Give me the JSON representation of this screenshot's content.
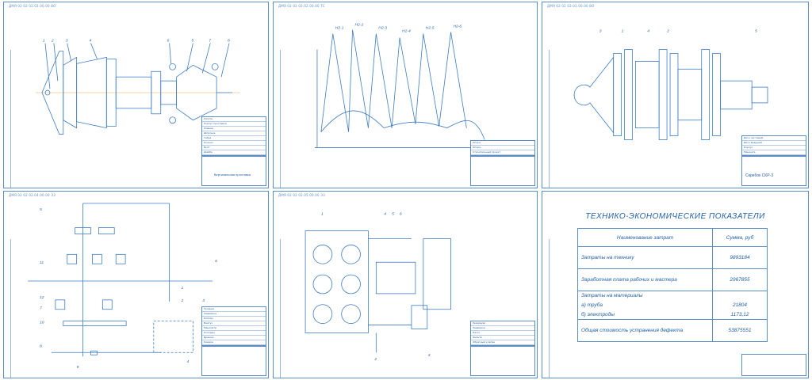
{
  "sheets": {
    "s1": {
      "code": "ДМЯ 02 02 02.02.00.00 ВО",
      "title": "Вертикальная проставка",
      "callouts": [
        "1",
        "2",
        "3",
        "4",
        "6",
        "5",
        "7",
        "8"
      ],
      "spec": [
        "Уплотн.",
        "Корпус проставки",
        "Фланец",
        "Шпилька",
        "Гайка",
        "Кольцо",
        "Болт",
        "Шайба"
      ]
    },
    "s2": {
      "code": "ДМЯ 02 02 02.02.00.00 ТС",
      "dims": [
        "H2-1",
        "H2-2",
        "H2-3",
        "H2-4",
        "H2-5",
        "H2-6"
      ],
      "spec": [
        "Опора",
        "Опора",
        "Строительный проект"
      ]
    },
    "s3": {
      "code": "ДМЯ 02 02 02.03.00.00 ВО",
      "title": "Скребок СКР-3",
      "callouts": [
        "3",
        "1",
        "4",
        "2",
        "5"
      ],
      "spec": [
        "Диск чистящий",
        "Диск ведущий",
        "Корпус",
        "Манжета"
      ]
    },
    "s4": {
      "code": "ДМЯ 02 02 02.04.00.00 Э3",
      "callouts": [
        "5",
        "11",
        "12",
        "7",
        "8",
        "9",
        "10",
        "6",
        "1",
        "2",
        "3",
        "4"
      ],
      "spec": [
        "Тройник",
        "Задвижка",
        "Клапан",
        "Вантуз",
        "Манометр",
        "Колодец",
        "Дренаж",
        "Камера"
      ]
    },
    "s5": {
      "code": "ДМЯ 02 02 02.05.00.00 Э3",
      "callouts": [
        "1",
        "4",
        "5",
        "6",
        "3",
        "2"
      ],
      "spec": [
        "Резервуар",
        "Задвижка",
        "Насос",
        "Фильтр",
        "Обратный клапан"
      ]
    }
  },
  "tep": {
    "title": "ТЕХНИКО-ЭКОНОМИЧЕСКИЕ ПОКАЗАТЕЛИ",
    "col_name": "Наименование затрат",
    "col_sum": "Сумма, руб",
    "rows": [
      {
        "name": "Затраты на технику",
        "value": "9893184"
      },
      {
        "name": "Заработная плата рабочих и мастера",
        "value": "2967855"
      },
      {
        "name": "Затраты на материалы",
        "value": ""
      },
      {
        "name": "а) труба",
        "value": "21804"
      },
      {
        "name": "б) электроды",
        "value": "1173,12"
      },
      {
        "name": "Общая стоимость устранения дефекта",
        "value": "53875551"
      }
    ]
  }
}
